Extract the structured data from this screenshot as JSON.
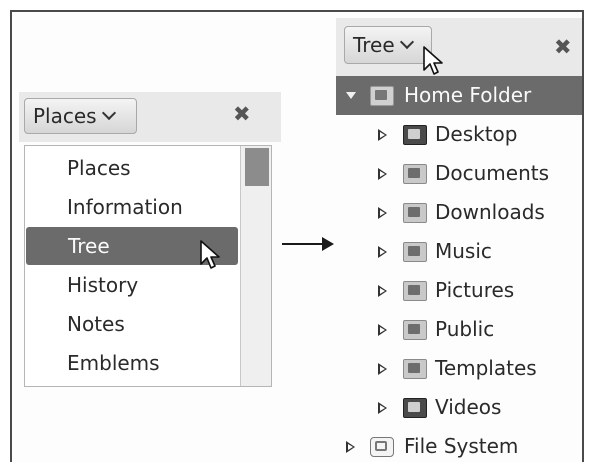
{
  "left_panel": {
    "selector_label": "Places",
    "menu_items": [
      {
        "label": "Places",
        "selected": false
      },
      {
        "label": "Information",
        "selected": false
      },
      {
        "label": "Tree",
        "selected": true
      },
      {
        "label": "History",
        "selected": false
      },
      {
        "label": "Notes",
        "selected": false
      },
      {
        "label": "Emblems",
        "selected": false
      }
    ]
  },
  "right_panel": {
    "selector_label": "Tree",
    "tree": [
      {
        "label": "Home Folder",
        "expanded": true,
        "selected": true,
        "icon": "home-folder-icon"
      },
      {
        "label": "Desktop",
        "expanded": false,
        "icon": "desktop-folder-icon"
      },
      {
        "label": "Documents",
        "expanded": false,
        "icon": "documents-folder-icon"
      },
      {
        "label": "Downloads",
        "expanded": false,
        "icon": "downloads-folder-icon"
      },
      {
        "label": "Music",
        "expanded": false,
        "icon": "music-folder-icon"
      },
      {
        "label": "Pictures",
        "expanded": false,
        "icon": "pictures-folder-icon"
      },
      {
        "label": "Public",
        "expanded": false,
        "icon": "public-folder-icon"
      },
      {
        "label": "Templates",
        "expanded": false,
        "icon": "templates-folder-icon"
      },
      {
        "label": "Videos",
        "expanded": false,
        "icon": "videos-folder-icon"
      },
      {
        "label": "File System",
        "expanded": false,
        "icon": "drive-icon"
      }
    ]
  },
  "colors": {
    "selection": "#6b6b6b",
    "header_bg": "#e9e9e9",
    "frame": "#4a4a4a"
  }
}
